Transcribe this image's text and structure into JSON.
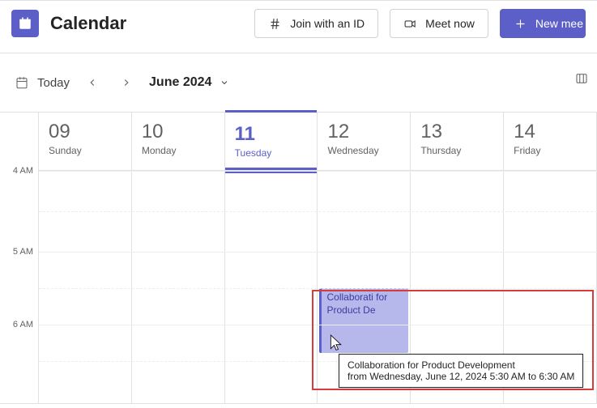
{
  "header": {
    "title": "Calendar",
    "join_label": "Join with an ID",
    "meet_label": "Meet now",
    "new_meeting_label": "New mee"
  },
  "subbar": {
    "today_label": "Today",
    "month_label": "June 2024"
  },
  "time_labels": {
    "t0": "4 AM",
    "t1": "5 AM",
    "t2": "6 AM"
  },
  "days": [
    {
      "num": "09",
      "name": "Sunday"
    },
    {
      "num": "10",
      "name": "Monday"
    },
    {
      "num": "11",
      "name": "Tuesday"
    },
    {
      "num": "12",
      "name": "Wednesday"
    },
    {
      "num": "13",
      "name": "Thursday"
    },
    {
      "num": "14",
      "name": "Friday"
    }
  ],
  "today_index": 2,
  "event": {
    "short_title": "Collaborati for Product De",
    "tooltip_title": "Collaboration for Product Development",
    "tooltip_time": "from Wednesday, June 12, 2024 5:30 AM to  6:30 AM"
  }
}
